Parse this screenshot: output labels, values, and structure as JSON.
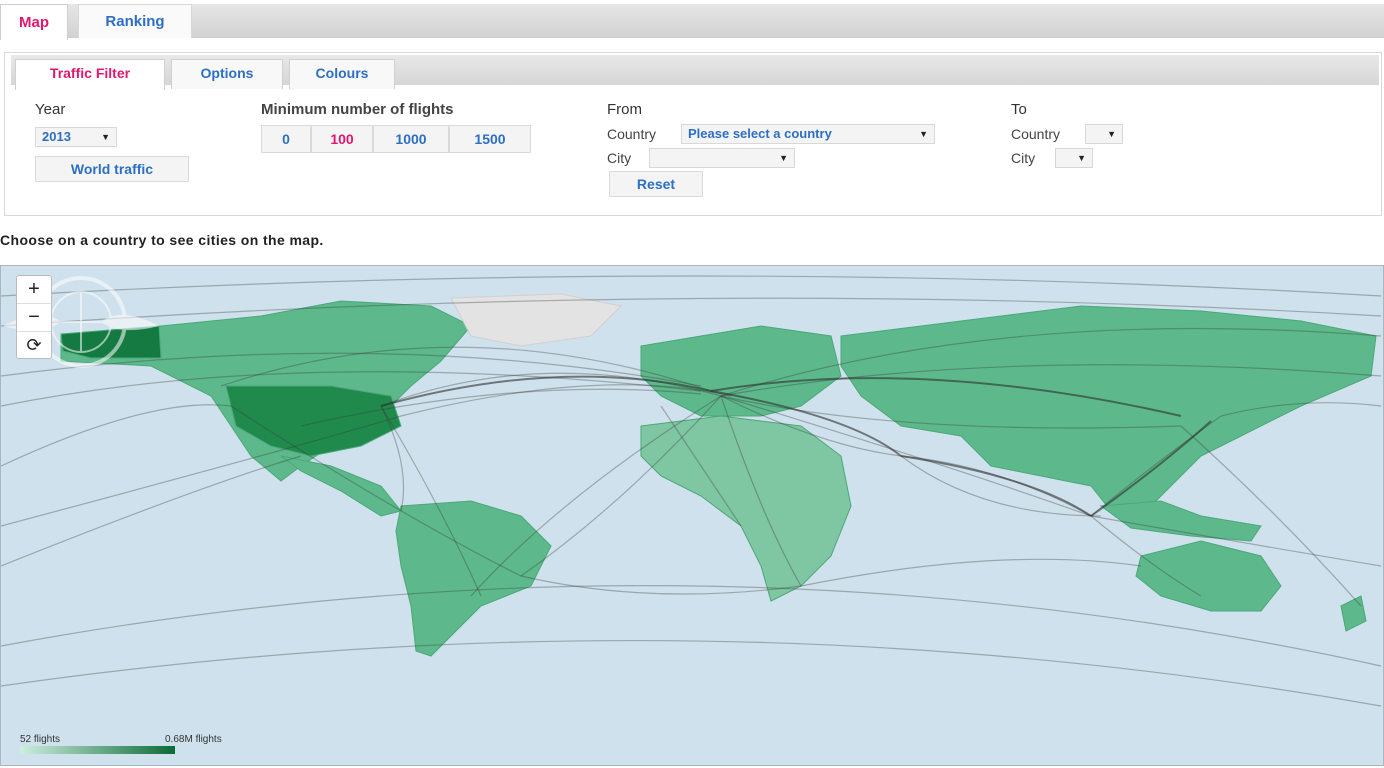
{
  "top_tabs": {
    "map": "Map",
    "ranking": "Ranking"
  },
  "sub_tabs": {
    "traffic_filter": "Traffic Filter",
    "options": "Options",
    "colours": "Colours"
  },
  "year": {
    "label": "Year",
    "value": "2013",
    "world_traffic": "World traffic"
  },
  "min_flights": {
    "label": "Minimum number of flights",
    "options": [
      "0",
      "100",
      "1000",
      "1500"
    ],
    "selected": "100"
  },
  "from": {
    "label": "From",
    "country_label": "Country",
    "country_value": "Please select a country",
    "city_label": "City",
    "city_value": "",
    "reset": "Reset"
  },
  "to": {
    "label": "To",
    "country_label": "Country",
    "country_value": "",
    "city_label": "City",
    "city_value": ""
  },
  "hint": "Choose on a country to see cities on the map.",
  "zoom": {
    "plus": "+",
    "minus": "−",
    "reset": "⟳"
  },
  "legend": {
    "min": "52 flights",
    "max": "0.68M flights"
  },
  "colors": {
    "accent": "#e0186d",
    "link": "#2d6fc4",
    "ocean": "#cfe1ec",
    "land": "#5db98c",
    "route": "#3a3a3a"
  }
}
